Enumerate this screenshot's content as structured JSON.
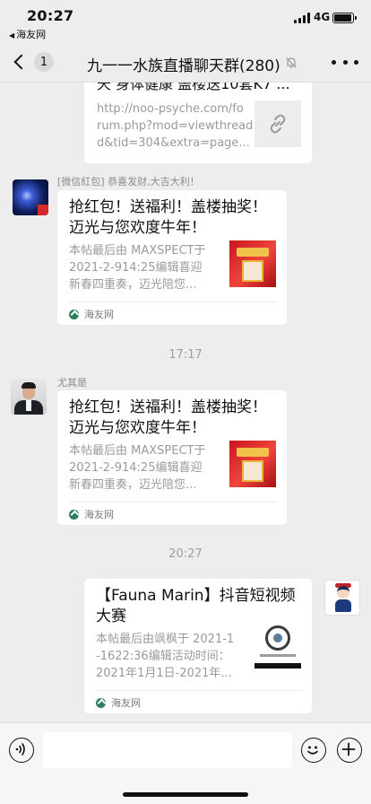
{
  "status_bar": {
    "time": "20:27",
    "back_app": "海友网",
    "network": "4G"
  },
  "nav": {
    "unread_count": "1",
    "title": "九一一水族直播聊天群(280)"
  },
  "messages": [
    {
      "type": "link_card_partial",
      "title_tail": "天 身体健康 盖楼送10套K7 ...",
      "url_lines": [
        "http://noo-psyche.com/fo",
        "rum.php?mod=viewthread",
        "d&tid=304&extra=page..."
      ]
    },
    {
      "type": "link_card",
      "sender": "[微信紅包] 恭喜发财,大吉大利！",
      "title_lines": [
        "抢红包！送福利！盖楼抽奖！",
        "迈光与您欢度牛年！"
      ],
      "desc_lines": [
        "本帖最后由 MAXSPECT于",
        "2021-2-914:25编辑喜迎",
        "新春四重奏，迈光陪您..."
      ],
      "source": "海友网"
    },
    {
      "type": "timestamp",
      "text": "17:17"
    },
    {
      "type": "link_card",
      "sender": "尤其是",
      "title_lines": [
        "抢红包！送福利！盖楼抽奖！",
        "迈光与您欢度牛年！"
      ],
      "desc_lines": [
        "本帖最后由 MAXSPECT于",
        "2021-2-914:25编辑喜迎",
        "新春四重奏，迈光陪您..."
      ],
      "source": "海友网"
    },
    {
      "type": "timestamp",
      "text": "20:27"
    },
    {
      "type": "link_card_self",
      "title_lines": [
        "【Fauna Marin】抖音短视频",
        "大赛"
      ],
      "desc_lines": [
        "本帖最后由飒枫于 2021-1",
        "-1622:36编辑活动时间：",
        "2021年1月1日-2021年..."
      ],
      "source": "海友网"
    }
  ],
  "icons": {
    "back": "chevron-left-icon",
    "mute": "bell-slash-icon",
    "more": "ellipsis-icon",
    "voice": "voice-icon",
    "emoji": "emoji-icon",
    "add": "plus-icon",
    "link": "link-icon",
    "source": "haiyou-logo-icon"
  },
  "colors": {
    "background": "#ededed",
    "card": "#ffffff",
    "meta_text": "#a0a0a0"
  }
}
